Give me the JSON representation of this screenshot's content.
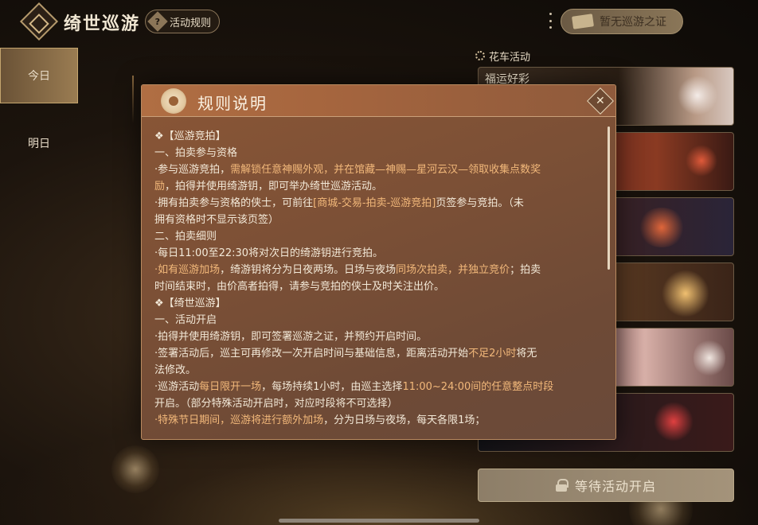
{
  "header": {
    "title": "绮世巡游",
    "rules_button": "活动规则",
    "pass_badge": "暂无巡游之证"
  },
  "days": [
    "今日",
    "明日"
  ],
  "side": {
    "section_label": "花车活动",
    "first_card_title": "福运好彩",
    "wait_button": "等待活动开启"
  },
  "dialog": {
    "title": "规则说明",
    "lines": [
      [
        {
          "t": "❖【巡游竞拍】"
        }
      ],
      [
        {
          "t": "一、拍卖参与资格"
        }
      ],
      [
        {
          "t": "·参与巡游竞拍，"
        },
        {
          "t": "需解锁任意神赐外观，并在馆藏—神赐—星河云汉—领取收集点数奖",
          "hl": true
        }
      ],
      [
        {
          "t": "励",
          "hl": true
        },
        {
          "t": "，拍得并使用绮游钥，即可举办绮世巡游活动。"
        }
      ],
      [
        {
          "t": "·拥有拍卖参与资格的侠士，可前往"
        },
        {
          "t": "[商城-交易-拍卖-巡游竞拍]",
          "hl": true
        },
        {
          "t": "页签参与竞拍。（未"
        }
      ],
      [
        {
          "t": "拥有资格时不显示该页签）"
        }
      ],
      [
        {
          "t": "二、拍卖细则"
        }
      ],
      [
        {
          "t": "·每日11:00至22:30将对次日的绮游钥进行竞拍。"
        }
      ],
      [
        {
          "t": "·如有巡游加场",
          "hl": true
        },
        {
          "t": "，绮游钥将分为日夜两场。日场与夜场"
        },
        {
          "t": "同场次拍卖，并独立竞价",
          "hl": true
        },
        {
          "t": "；拍卖"
        }
      ],
      [
        {
          "t": "时间结束时，由价高者拍得，请参与竞拍的侠士及时关注出价。"
        }
      ],
      [
        {
          "t": "❖【绮世巡游】"
        }
      ],
      [
        {
          "t": "一、活动开启"
        }
      ],
      [
        {
          "t": "·拍得并使用绮游钥，即可签署巡游之证，并预约开启时间。"
        }
      ],
      [
        {
          "t": "·签署活动后，巡主可再修改一次开启时间与基础信息，距离活动开始"
        },
        {
          "t": "不足2小时",
          "hl": true
        },
        {
          "t": "将无"
        }
      ],
      [
        {
          "t": "法修改。"
        }
      ],
      [
        {
          "t": "·巡游活动"
        },
        {
          "t": "每日限开一场",
          "hl": true
        },
        {
          "t": "，每场持续1小时，由巡主选择"
        },
        {
          "t": "11:00~24:00间的任意整点时段",
          "hl": true
        }
      ],
      [
        {
          "t": "开启。（部分特殊活动开启时，对应时段将不可选择）"
        }
      ],
      [
        {
          "t": "·特殊节日期间，巡游将进行额外加场",
          "hl": true
        },
        {
          "t": "，分为日场与夜场，每天各限1场；"
        }
      ]
    ]
  },
  "colors": {
    "accent": "#f2b87a",
    "dialog_bg": "#7c5036",
    "header_bg": "#a5653e"
  }
}
